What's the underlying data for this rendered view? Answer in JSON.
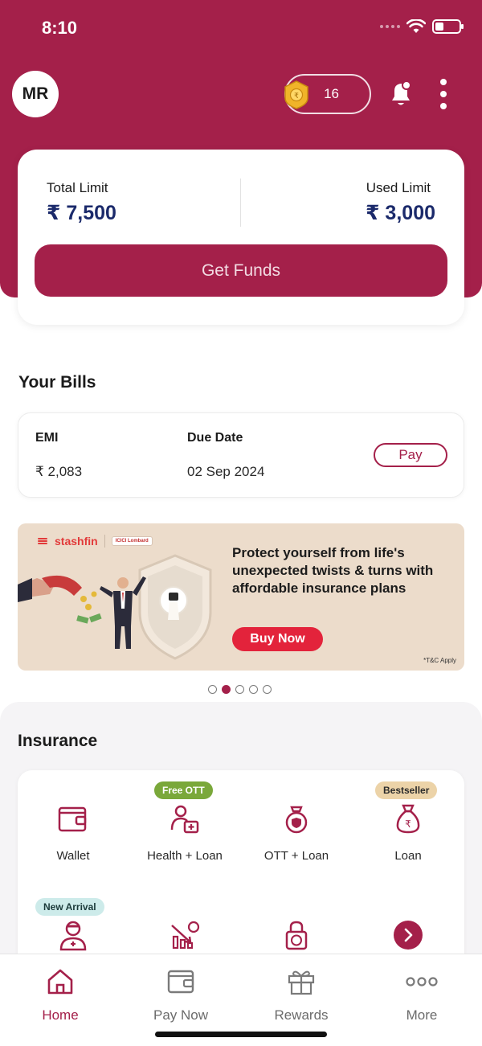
{
  "status_bar": {
    "time": "8:10"
  },
  "header": {
    "avatar_initials": "MR",
    "coin_count": "16",
    "accent_color": "#a4204a"
  },
  "limits": {
    "total_label": "Total Limit",
    "total_value": "₹ 7,500",
    "used_label": "Used Limit",
    "used_value": "₹ 3,000",
    "cta_label": "Get Funds"
  },
  "bills": {
    "section_title": "Your Bills",
    "emi_label": "EMI",
    "emi_value": "₹ 2,083",
    "due_label": "Due Date",
    "due_value": "02 Sep 2024",
    "pay_label": "Pay"
  },
  "banner": {
    "brand": "stashfin",
    "partner": "ICICI Lombard",
    "headline": "Protect yourself from life's unexpected twists & turns with affordable insurance plans",
    "cta_label": "Buy Now",
    "tnc": "*T&C Apply",
    "carousel_total": 5,
    "carousel_active_index": 1
  },
  "insurance": {
    "section_title": "Insurance",
    "tiles": [
      {
        "label": "Wallet",
        "icon": "wallet-icon",
        "badge": ""
      },
      {
        "label": "Health + Loan",
        "icon": "health-loan-icon",
        "badge": "Free OTT"
      },
      {
        "label": "OTT + Loan",
        "icon": "ott-loan-icon",
        "badge": ""
      },
      {
        "label": "Loan",
        "icon": "money-bag-icon",
        "badge": "Bestseller"
      },
      {
        "label": "",
        "icon": "doctor-icon",
        "badge": "New Arrival"
      },
      {
        "label": "",
        "icon": "market-down-icon",
        "badge": ""
      },
      {
        "label": "",
        "icon": "lock-rupee-icon",
        "badge": ""
      },
      {
        "label": "",
        "icon": "chevron-right-icon",
        "badge": ""
      }
    ],
    "badge_colors": {
      "Free OTT": "#7aa83a",
      "Bestseller": "#ecd3a8",
      "New Arrival": "#cdebea"
    }
  },
  "bottom_nav": {
    "items": [
      {
        "label": "Home",
        "icon": "home-icon",
        "active": true
      },
      {
        "label": "Pay Now",
        "icon": "wallet-outline-icon",
        "active": false
      },
      {
        "label": "Rewards",
        "icon": "gift-icon",
        "active": false
      },
      {
        "label": "More",
        "icon": "more-dots-icon",
        "active": false
      }
    ]
  }
}
